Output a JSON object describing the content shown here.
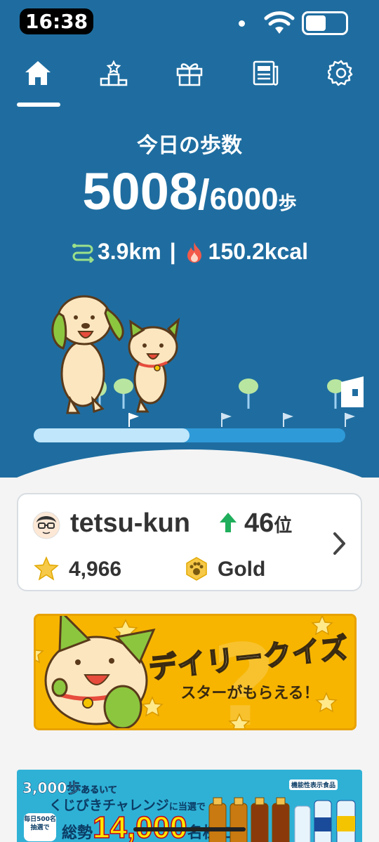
{
  "status_bar": {
    "time": "16:38"
  },
  "nav": {
    "items": [
      {
        "icon": "home-icon",
        "active": true
      },
      {
        "icon": "ranking-podium-icon",
        "active": false
      },
      {
        "icon": "gift-icon",
        "active": false
      },
      {
        "icon": "news-icon",
        "active": false
      },
      {
        "icon": "gear-icon",
        "active": false
      }
    ]
  },
  "steps": {
    "title": "今日の歩数",
    "current": "5008",
    "separator": "/",
    "goal": "6000",
    "unit": "歩",
    "progress_fraction": 0.5
  },
  "stats": {
    "distance": "3.9km",
    "divider": "|",
    "calories": "150.2kcal"
  },
  "profile": {
    "username": "tetsu-kun",
    "rank": "46",
    "rank_unit": "位",
    "points": "4,966",
    "tier": "Gold"
  },
  "quiz_banner": {
    "title": "デイリークイズ",
    "subtitle": "スターがもらえる！"
  },
  "ad_banner": {
    "line1_main": "3,000歩",
    "line1_small": "あるいて",
    "line2_main": "くじびきチャレンジ",
    "line2_small": "に当選で",
    "pill": "毎日500名抽選で",
    "big_prefix": "総勢",
    "big_number": "14,000",
    "big_suffix": "名様に",
    "tag": "機能性表示食品"
  },
  "colors": {
    "brand_blue": "#1f6da0",
    "progress_fill": "#bfe6fb",
    "progress_track": "#2f9ad8",
    "quiz_yellow": "#f7b500",
    "rank_up_green": "#1fae5b"
  }
}
